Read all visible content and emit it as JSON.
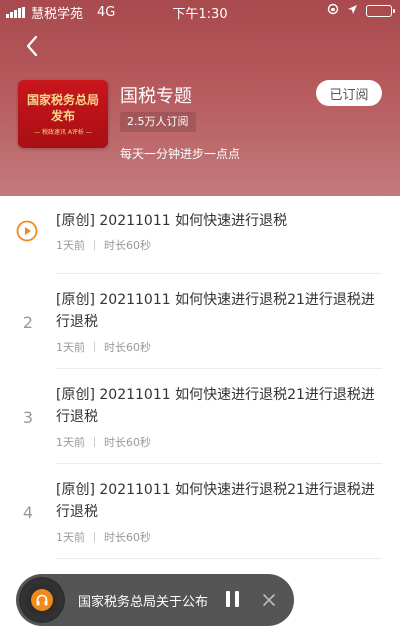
{
  "status_bar": {
    "carrier": "慧税学苑",
    "network": "4G",
    "time": "下午1:30"
  },
  "header": {
    "title": "国税专题",
    "subscribers": "2.5万人订阅",
    "description": "每天一分钟进步一点点",
    "subscribe_label": "已订阅",
    "cover": {
      "line1": "国家税务总局",
      "line2": "发布",
      "line3": "— 税政速讯 A评析 —"
    }
  },
  "episodes": [
    {
      "index": "",
      "playing": true,
      "title": "[原创] 20211011 如何快速进行退税",
      "time_ago": "1天前",
      "duration": "时长60秒"
    },
    {
      "index": "2",
      "playing": false,
      "title": "[原创] 20211011 如何快速进行退税21进行退税进行退税",
      "time_ago": "1天前",
      "duration": "时长60秒"
    },
    {
      "index": "3",
      "playing": false,
      "title": "[原创] 20211011 如何快速进行退税21进行退税进行退税",
      "time_ago": "1天前",
      "duration": "时长60秒"
    },
    {
      "index": "4",
      "playing": false,
      "title": "[原创] 20211011 如何快速进行退税21进行退税进行退税",
      "time_ago": "1天前",
      "duration": "时长60秒"
    }
  ],
  "player": {
    "title": "国家税务总局关于公布"
  },
  "colors": {
    "accent": "#f08a1a",
    "header": "#b65a5d"
  }
}
